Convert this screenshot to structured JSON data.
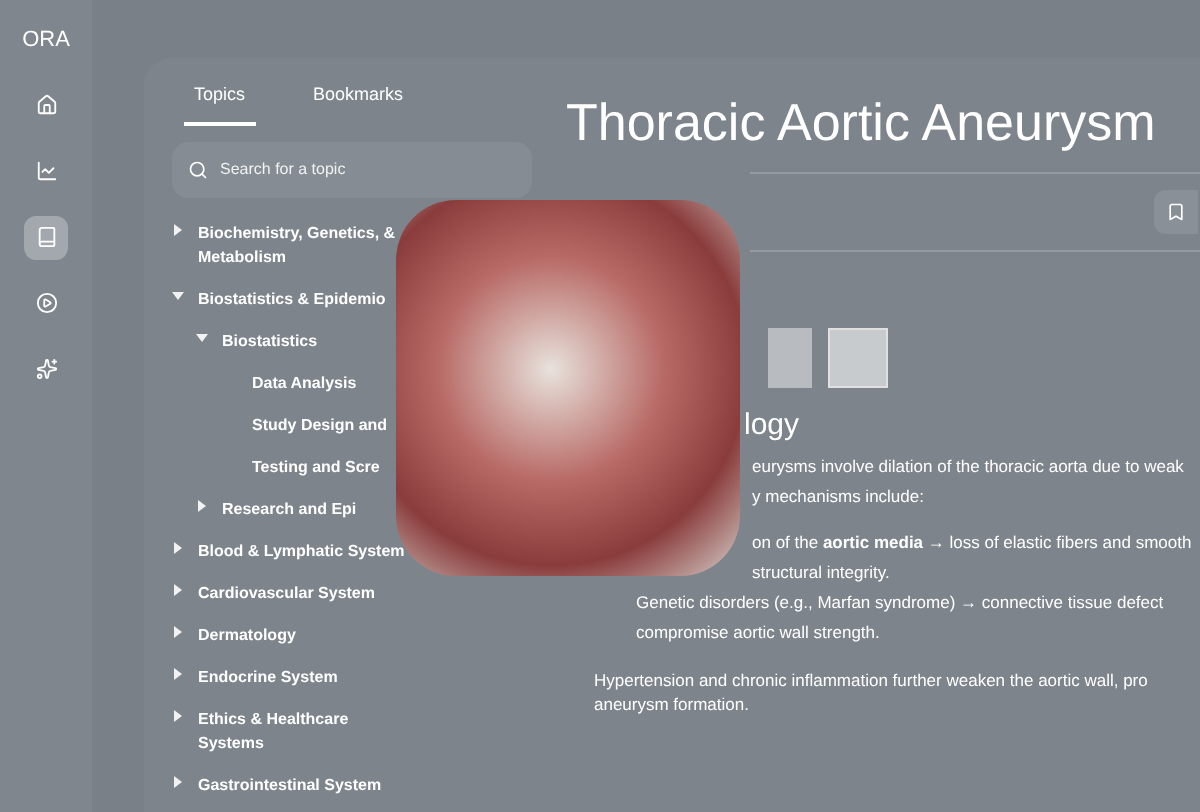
{
  "sidebar": {
    "logo": "ORA",
    "items": [
      {
        "selected": false
      },
      {
        "selected": false
      },
      {
        "selected": true
      },
      {
        "selected": false
      },
      {
        "selected": false
      }
    ]
  },
  "tabs": [
    {
      "label": "Topics",
      "selected": true
    },
    {
      "label": "Bookmarks",
      "selected": false
    }
  ],
  "search": {
    "placeholder": "Search for a topic"
  },
  "topics": [
    {
      "label": "Biochemistry, Genetics, & Metabolism",
      "expanded": false
    },
    {
      "label": "Biostatistics & Epidemio",
      "expanded": true,
      "children": [
        {
          "label": "Biostatistics",
          "expanded": true,
          "children": [
            {
              "label": "Data Analysis"
            },
            {
              "label": "Study Design and"
            },
            {
              "label": "Testing and Scre"
            }
          ]
        },
        {
          "label": "Research and Epi",
          "expanded": false
        }
      ]
    },
    {
      "label": "Blood & Lymphatic System",
      "expanded": false
    },
    {
      "label": "Cardiovascular System",
      "expanded": false
    },
    {
      "label": "Dermatology",
      "expanded": false
    },
    {
      "label": "Endocrine System",
      "expanded": false
    },
    {
      "label": "Ethics & Healthcare Systems",
      "expanded": false
    },
    {
      "label": "Gastrointestinal System",
      "expanded": false
    }
  ],
  "article": {
    "title": "Thoracic Aortic Aneurysm",
    "heading": "logy",
    "lines_upper": [
      "eurysms involve dilation of the thoracic aorta due to weak",
      "y mechanisms include:",
      "on of the **aortic media** → loss of elastic fibers and smooth",
      "structural integrity."
    ],
    "lines_lower": [
      "Genetic disorders (e.g., Marfan syndrome) → connective tissue defect",
      "compromise aortic wall strength."
    ],
    "paragraph": "Hypertension and chronic inflammation further weaken the aortic wall, pro aneurysm formation."
  }
}
